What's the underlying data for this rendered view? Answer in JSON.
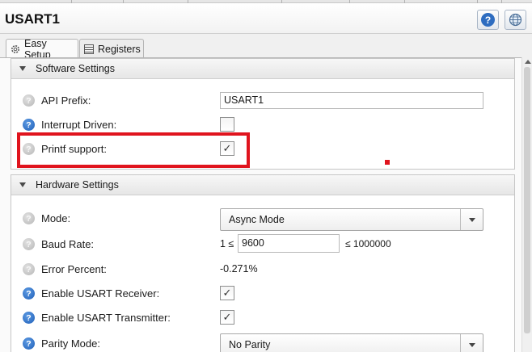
{
  "window": {
    "title": "USART1"
  },
  "toolbar": {
    "help_icon": "question-circle-icon",
    "globe_icon": "globe-icon"
  },
  "tabs": [
    {
      "label": "Easy Setup",
      "icon": "gear-cog-icon",
      "active": true
    },
    {
      "label": "Registers",
      "icon": "registers-table-icon",
      "active": false
    }
  ],
  "software_settings": {
    "header": "Software Settings",
    "api_prefix": {
      "label": "API Prefix:",
      "value": "USART1",
      "help": "gray"
    },
    "interrupt_driven": {
      "label": "Interrupt Driven:",
      "checked": false,
      "help": "blue"
    },
    "printf_support": {
      "label": "Printf support:",
      "checked": true,
      "help": "gray",
      "check_mark": "✓"
    }
  },
  "hardware_settings": {
    "header": "Hardware Settings",
    "mode": {
      "label": "Mode:",
      "selected": "Async Mode"
    },
    "baud_rate": {
      "label": "Baud Rate:",
      "min_text": "1 ≤",
      "value": "9600",
      "max_text": "≤ 1000000"
    },
    "error_percent": {
      "label": "Error Percent:",
      "value": "-0.271%"
    },
    "enable_receiver": {
      "label": "Enable USART Receiver:",
      "checked": true,
      "check_mark": "✓"
    },
    "enable_transmitter": {
      "label": "Enable USART Transmitter:",
      "checked": true,
      "check_mark": "✓"
    },
    "parity_mode": {
      "label": "Parity Mode:",
      "selected": "No Parity"
    }
  },
  "annotation": {
    "highlight_color": "#e0141e"
  },
  "colors": {
    "help_blue": "#2d6cc0",
    "help_gray": "#b6b6b6"
  }
}
